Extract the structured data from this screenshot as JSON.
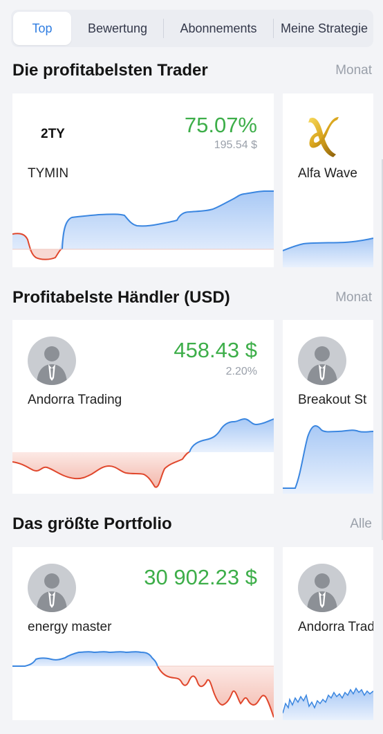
{
  "tabs": [
    {
      "label": "Top",
      "active": true
    },
    {
      "label": "Bewertung",
      "active": false
    },
    {
      "label": "Abonnements",
      "active": false
    },
    {
      "label": "Meine Strategie",
      "active": false
    }
  ],
  "sections": [
    {
      "title": "Die profitabelsten Trader",
      "filter": "Monat",
      "cards": [
        {
          "name": "TYMIN",
          "logo_text": "2TY",
          "value": "75.07%",
          "subvalue": "195.54 $",
          "icon": "tymin-logo"
        },
        {
          "name": "Alfa Wave",
          "icon": "alfa-wave-logo"
        }
      ]
    },
    {
      "title": "Profitabelste Händler (USD)",
      "filter": "Monat",
      "cards": [
        {
          "name": "Andorra Trading",
          "value": "458.43 $",
          "subvalue": "2.20%",
          "icon": "user-avatar-icon"
        },
        {
          "name": "Breakout St",
          "icon": "user-avatar-icon"
        }
      ]
    },
    {
      "title": "Das größte Portfolio",
      "filter": "Alle",
      "cards": [
        {
          "name": "energy master",
          "value": "30 902.23 $",
          "icon": "user-avatar-icon"
        },
        {
          "name": "Andorra Trad",
          "icon": "user-avatar-icon"
        }
      ]
    }
  ],
  "colors": {
    "accent": "#2f7de1",
    "profit": "#3dae49",
    "loss_line": "#e0472c",
    "gain_line": "#3a86e0",
    "background": "#f3f4f7"
  }
}
